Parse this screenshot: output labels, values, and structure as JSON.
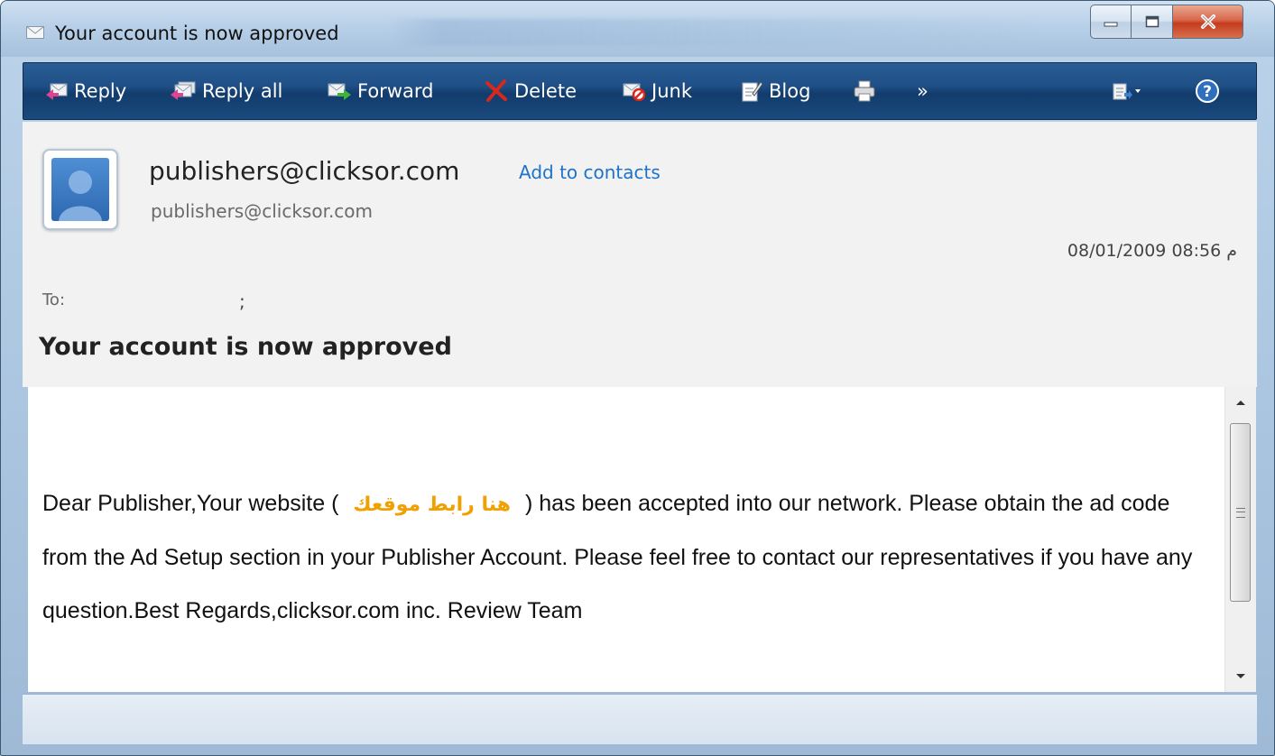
{
  "window": {
    "title": "Your account is now approved",
    "icon": "envelope-icon"
  },
  "toolbar": {
    "reply": "Reply",
    "reply_all": "Reply all",
    "forward": "Forward",
    "delete": "Delete",
    "junk": "Junk",
    "blog": "Blog",
    "more": "»"
  },
  "header": {
    "sender_name": "publishers@clicksor.com",
    "add_contacts": "Add to contacts",
    "sender_email": "publishers@clicksor.com",
    "datetime": "08/01/2009 08:56 م",
    "to_label": "To:",
    "to_value": ";",
    "subject": "Your account is now approved"
  },
  "message": {
    "part1": "Dear Publisher,Your website (",
    "placeholder": "هنا رابط موقعك",
    "part2": ") has been accepted into our network. Please obtain the ad code from the Ad Setup section in your Publisher Account. Please feel free to contact our representatives if you have any question.Best Regards,clicksor.com inc. Review Team"
  },
  "colors": {
    "toolbar_bg": "#1f4f86",
    "link": "#1e73c8",
    "placeholder_text": "#f0a000",
    "close_button": "#c53c1c"
  }
}
